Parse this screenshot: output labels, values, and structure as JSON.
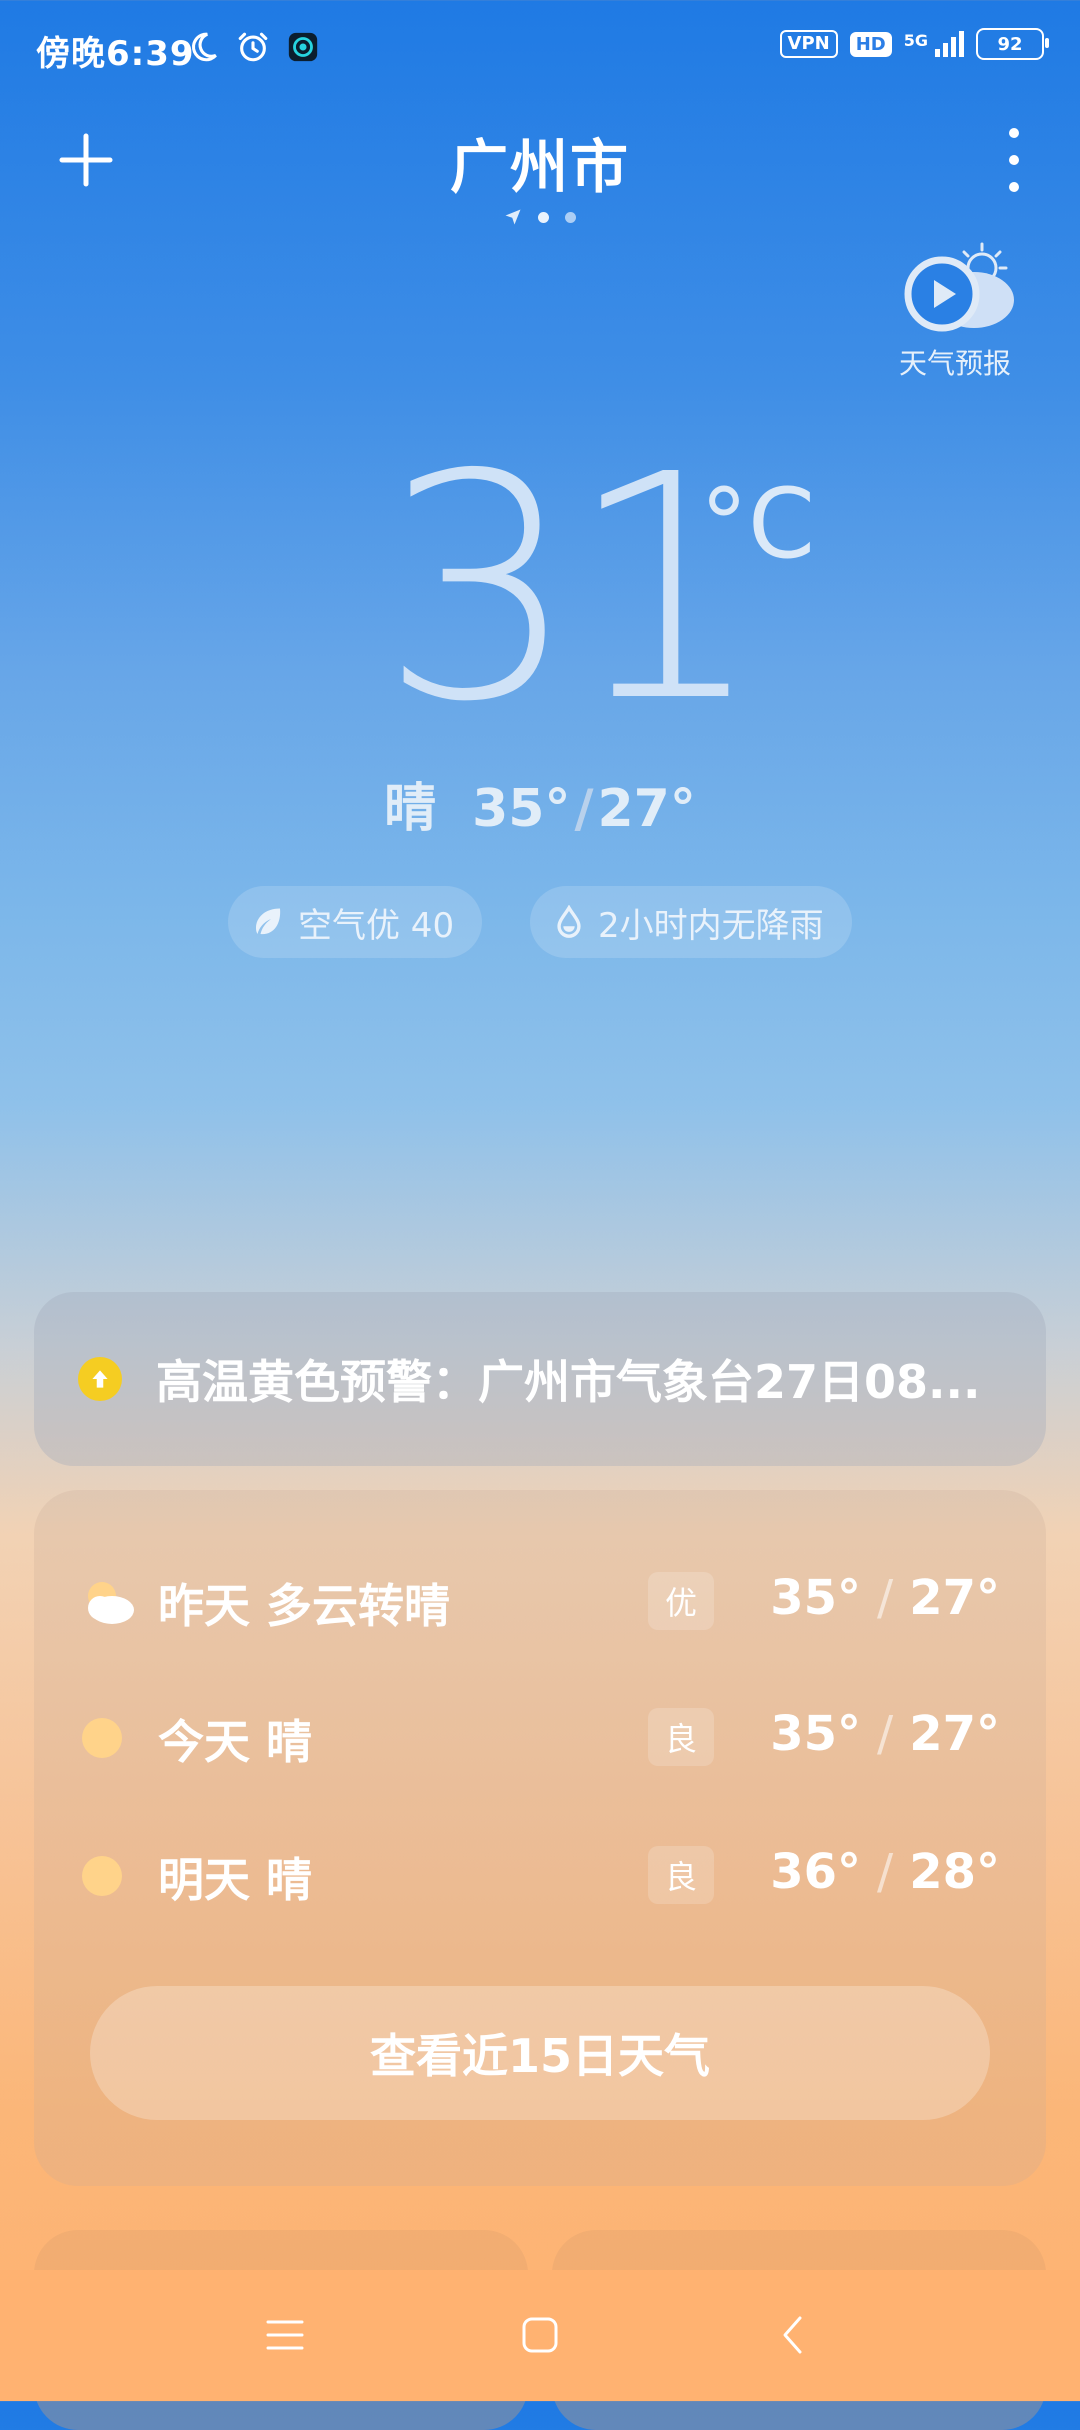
{
  "status_bar": {
    "time": "傍晚6:39",
    "vpn_label": "VPN",
    "hd_label": "HD",
    "network_label": "5G",
    "battery_level": "92"
  },
  "header": {
    "city": "广州市",
    "page_count": 3,
    "current_page": 0
  },
  "forecast_video": {
    "label": "天气预报"
  },
  "current": {
    "temperature": "31",
    "unit": "°C",
    "condition": "晴",
    "high": "35°",
    "low": "27°",
    "separator": "/"
  },
  "chips": {
    "air_quality": "空气优 40",
    "rain": "2小时内无降雨"
  },
  "alert": {
    "text": "高温黄色预警：广州市气象台27日08..."
  },
  "daily": [
    {
      "label": "昨天  多云转晴",
      "aqi": "优",
      "high": "35°",
      "low": "27°",
      "icon": "partly-cloudy-icon"
    },
    {
      "label": "今天  晴",
      "aqi": "良",
      "high": "35°",
      "low": "27°",
      "icon": "sunny-icon"
    },
    {
      "label": "明天  晴",
      "aqi": "良",
      "high": "36°",
      "low": "28°",
      "icon": "sunny-icon"
    }
  ],
  "daily_separator": "/",
  "more_days_button": "查看近15日天气",
  "colors": {
    "sky_top": "#1f7ae4",
    "sun": "#ffd38a",
    "alert_yellow": "#f5cd22",
    "nav_bar": "#ffb271"
  }
}
